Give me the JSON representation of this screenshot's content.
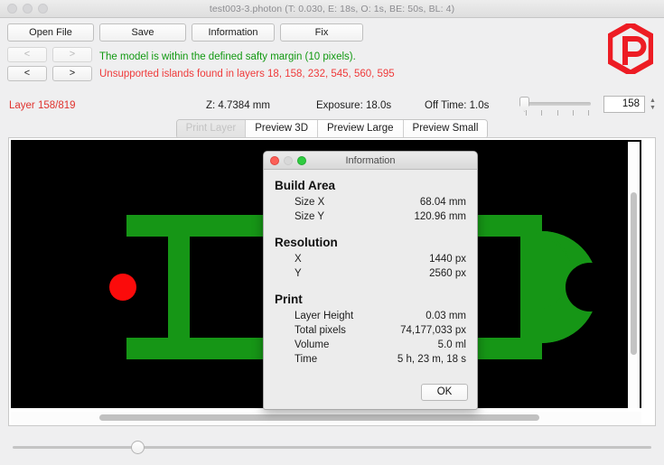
{
  "window": {
    "title": "test003-3.photon (T: 0.030, E: 18s, O: 1s, BE: 50s, BL: 4)"
  },
  "toolbar": {
    "open_file": "Open File",
    "save": "Save",
    "information": "Information",
    "fix": "Fix",
    "nav": {
      "prev_disabled": "<",
      "next_disabled": ">",
      "prev": "<",
      "next": ">"
    },
    "messages": {
      "ok": "The model is within the defined safty margin (10 pixels).",
      "warning": "Unsupported islands found in layers 18, 158, 232, 545, 560, 595"
    },
    "logo": "photon-logo-icon"
  },
  "status": {
    "layer": "Layer 158/819",
    "z": "Z: 4.7384 mm",
    "exposure": "Exposure: 18.0s",
    "off_time": "Off Time: 1.0s",
    "layer_value": "158",
    "stepper_up": "▲",
    "stepper_down": "▼"
  },
  "tabs": [
    {
      "label": "Print Layer",
      "selected": true
    },
    {
      "label": "Preview 3D",
      "selected": false
    },
    {
      "label": "Preview Large",
      "selected": false
    },
    {
      "label": "Preview Small",
      "selected": false
    }
  ],
  "preview": {
    "background_color": "#000000",
    "model_color": "#169616",
    "island_color": "#fb0b0b"
  },
  "dialog": {
    "title": "Information",
    "sections": [
      {
        "heading": "Build Area",
        "rows": [
          {
            "key": "Size X",
            "value": "68.04 mm"
          },
          {
            "key": "Size Y",
            "value": "120.96 mm"
          }
        ]
      },
      {
        "heading": "Resolution",
        "rows": [
          {
            "key": "X",
            "value": "1440 px"
          },
          {
            "key": "Y",
            "value": "2560 px"
          }
        ]
      },
      {
        "heading": "Print",
        "rows": [
          {
            "key": "Layer Height",
            "value": "0.03 mm"
          },
          {
            "key": "Total pixels",
            "value": "74,177,033 px"
          },
          {
            "key": "Volume",
            "value": "5.0 ml"
          },
          {
            "key": "Time",
            "value": "5 h, 23 m, 18 s"
          }
        ]
      }
    ],
    "ok": "OK"
  }
}
